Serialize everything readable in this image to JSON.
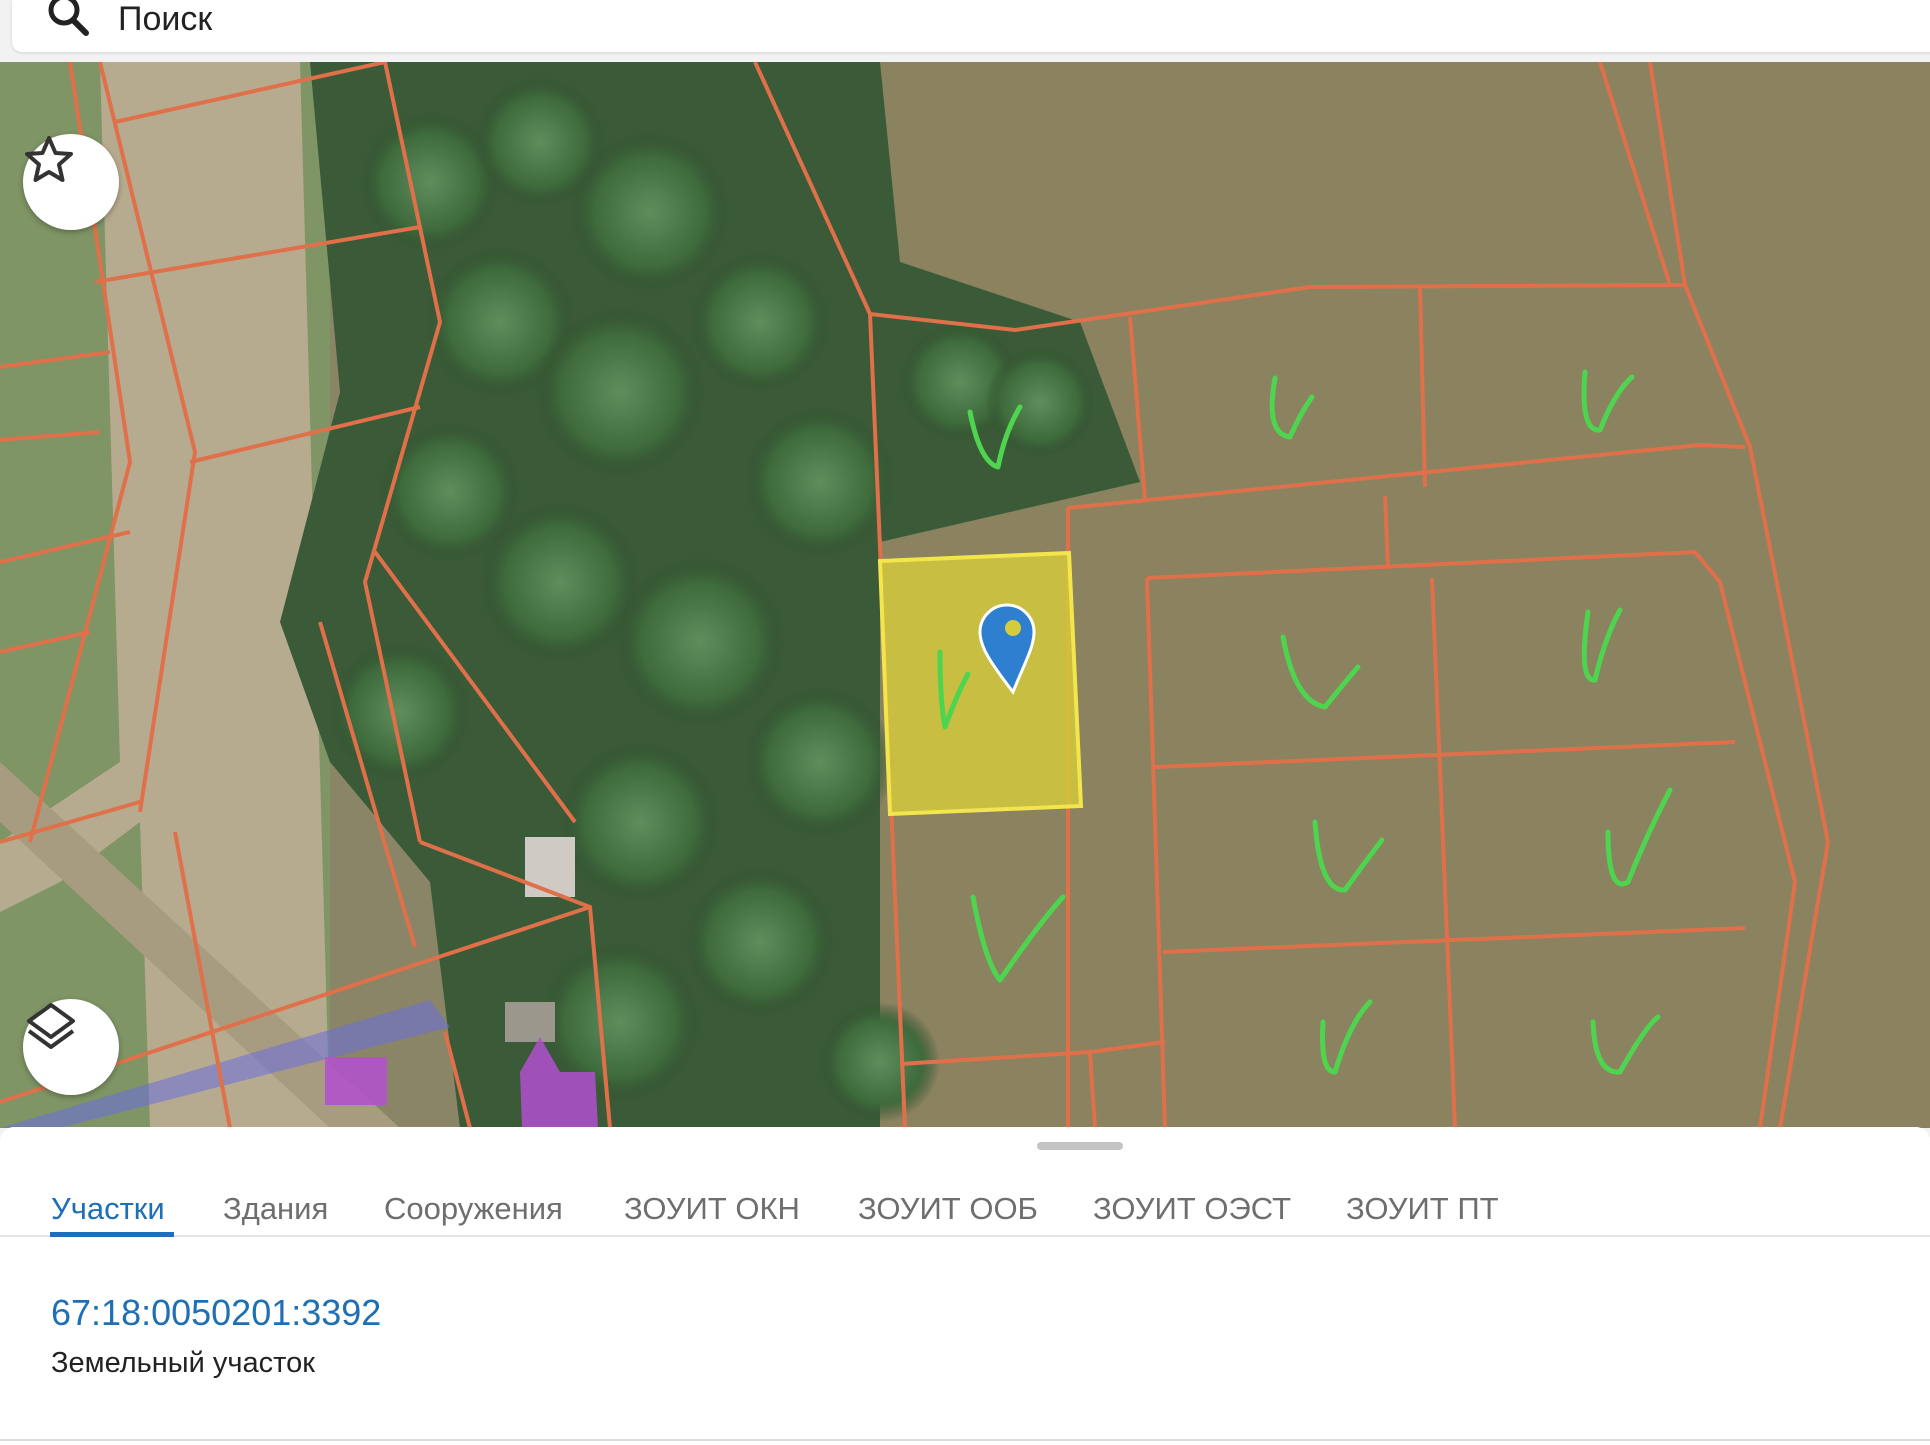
{
  "search": {
    "placeholder": "Поиск"
  },
  "map": {
    "favorite_icon": "star-icon",
    "layers_icon": "layers-icon",
    "selected_marker_icon": "map-pin-icon",
    "colors": {
      "parcel_border": "#e0704a",
      "selected_fill": "#d4cc3c",
      "selected_border": "#f3e64d",
      "check_marks": "#4fd44f",
      "pin": "#2f7fd1",
      "building_highlight": "#b34fd0",
      "road_overlay": "#6a6ee0"
    }
  },
  "tabs": [
    {
      "label": "Участки",
      "active": true
    },
    {
      "label": "Здания",
      "active": false
    },
    {
      "label": "Сооружения",
      "active": false
    },
    {
      "label": "ЗОУИТ ОКН",
      "active": false
    },
    {
      "label": "ЗОУИТ ООБ",
      "active": false
    },
    {
      "label": "ЗОУИТ ОЭСТ",
      "active": false
    },
    {
      "label": "ЗОУИТ ПТ",
      "active": false
    }
  ],
  "result": {
    "cadastral_number": "67:18:0050201:3392",
    "type": "Земельный участок"
  },
  "colors": {
    "accent": "#1e6fb3",
    "tab_inactive": "#6e6e6e"
  }
}
